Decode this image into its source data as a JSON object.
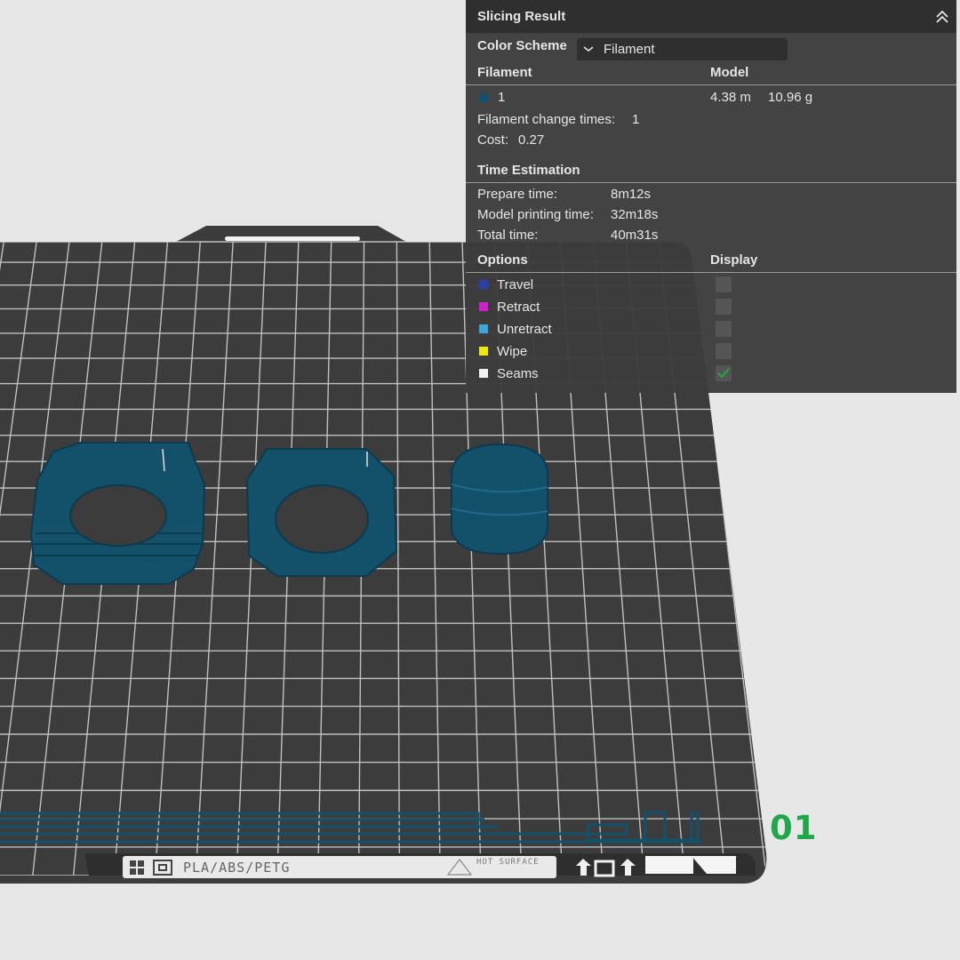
{
  "colors": {
    "background": "#e7e7e7",
    "plate": "#3c3c3c",
    "grid": "#d0d0d0",
    "model": "#13506a",
    "model_stroke": "#0c3a4e",
    "plate_label": "#1ea84a",
    "checkmark": "#1eae3e"
  },
  "panel": {
    "title": "Slicing Result",
    "collapse_icon": "double-chevron-up-icon",
    "color_scheme_label": "Color Scheme",
    "color_scheme_value": "Filament",
    "filament_header": "Filament",
    "model_header": "Model",
    "filament": {
      "id": "1",
      "swatch_color": "#13506a",
      "length": "4.38 m",
      "weight": "10.96 g"
    },
    "change_times_label": "Filament change times:",
    "change_times_value": "1",
    "cost_label": "Cost:",
    "cost_value": "0.27",
    "time_estimation_header": "Time Estimation",
    "times": [
      {
        "label": "Prepare time:",
        "value": "8m12s"
      },
      {
        "label": "Model printing time:",
        "value": "32m18s"
      },
      {
        "label": "Total time:",
        "value": "40m31s"
      }
    ],
    "options_header": "Options",
    "display_header": "Display",
    "options": [
      {
        "label": "Travel",
        "color": "#2b3fa8",
        "checked": false
      },
      {
        "label": "Retract",
        "color": "#d020d0",
        "checked": false
      },
      {
        "label": "Unretract",
        "color": "#3aa8d8",
        "checked": false
      },
      {
        "label": "Wipe",
        "color": "#f0e800",
        "checked": false
      },
      {
        "label": "Seams",
        "color": "#f0f0f0",
        "checked": true
      }
    ]
  },
  "plate": {
    "label": "01",
    "material_label": "PLA/ABS/PETG",
    "warning_text": "HOT SURFACE",
    "warning_icon": "warning-triangle-icon",
    "logo_icon": "logo-icon",
    "plate_icon": "plate-icon",
    "arrow_icon": "upload-arrow-icon"
  }
}
